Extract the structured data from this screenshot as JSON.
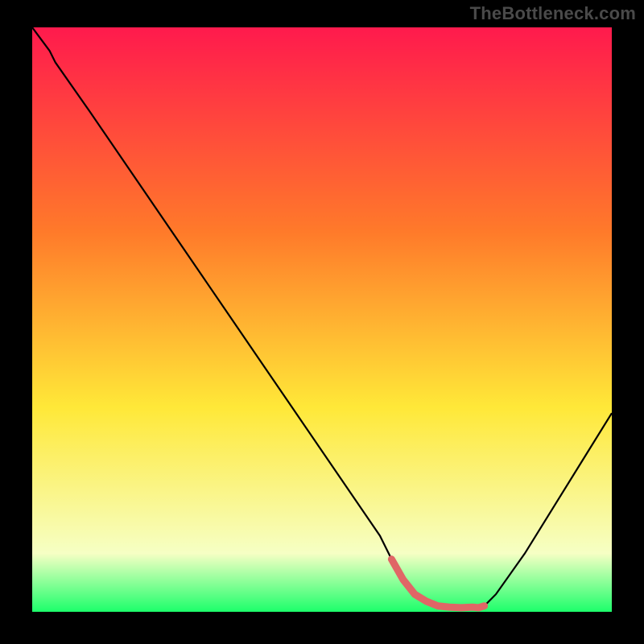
{
  "watermark": "TheBottleneck.com",
  "colors": {
    "background": "#000000",
    "gradient_top": "#ff1a4d",
    "gradient_mid1": "#ff7a2a",
    "gradient_mid2": "#ffe838",
    "gradient_bottom_pale": "#f6ffc4",
    "gradient_bottom": "#1cff6b",
    "curve": "#000000",
    "highlight": "#e06666"
  },
  "chart_data": {
    "type": "line",
    "title": "",
    "xlabel": "",
    "ylabel": "",
    "xlim": [
      0,
      100
    ],
    "ylim": [
      0,
      100
    ],
    "series": [
      {
        "name": "bottleneck-curve",
        "x": [
          0,
          3,
          4,
          10,
          20,
          30,
          40,
          50,
          60,
          62,
          65,
          70,
          75,
          77,
          78,
          80,
          85,
          90,
          95,
          100
        ],
        "y": [
          100,
          96,
          94,
          85.5,
          71,
          56.5,
          42,
          27.5,
          13,
          9,
          4,
          1,
          0.7,
          0.7,
          1,
          3,
          10,
          18,
          26,
          34
        ]
      }
    ],
    "highlight_segment": {
      "name": "optimal-range",
      "x": [
        62,
        64,
        66,
        68,
        70,
        72,
        74,
        76,
        77,
        78
      ],
      "y": [
        9,
        5.5,
        3,
        1.8,
        1,
        0.8,
        0.7,
        0.8,
        0.7,
        1
      ]
    }
  }
}
